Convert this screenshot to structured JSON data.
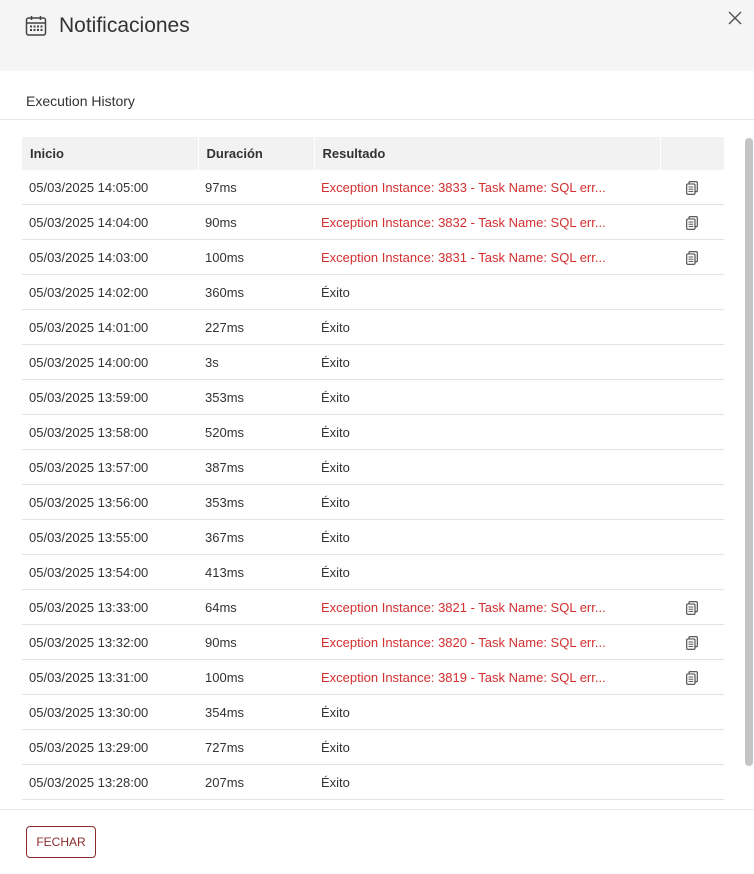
{
  "dialog": {
    "title": "Notificaciones",
    "subtitle": "Execution History",
    "close_icon": "close-icon",
    "title_icon": "calendar-icon"
  },
  "table": {
    "columns": [
      "Inicio",
      "Duración",
      "Resultado",
      ""
    ],
    "rows": [
      {
        "inicio": "05/03/2025 14:05:00",
        "duracion": "97ms",
        "resultado": "Exception Instance: 3833 - Task Name: SQL err...",
        "error": true
      },
      {
        "inicio": "05/03/2025 14:04:00",
        "duracion": "90ms",
        "resultado": "Exception Instance: 3832 - Task Name: SQL err...",
        "error": true
      },
      {
        "inicio": "05/03/2025 14:03:00",
        "duracion": "100ms",
        "resultado": "Exception Instance: 3831 - Task Name: SQL err...",
        "error": true
      },
      {
        "inicio": "05/03/2025 14:02:00",
        "duracion": "360ms",
        "resultado": "Éxito",
        "error": false
      },
      {
        "inicio": "05/03/2025 14:01:00",
        "duracion": "227ms",
        "resultado": "Éxito",
        "error": false
      },
      {
        "inicio": "05/03/2025 14:00:00",
        "duracion": "3s",
        "resultado": "Éxito",
        "error": false
      },
      {
        "inicio": "05/03/2025 13:59:00",
        "duracion": "353ms",
        "resultado": "Éxito",
        "error": false
      },
      {
        "inicio": "05/03/2025 13:58:00",
        "duracion": "520ms",
        "resultado": "Éxito",
        "error": false
      },
      {
        "inicio": "05/03/2025 13:57:00",
        "duracion": "387ms",
        "resultado": "Éxito",
        "error": false
      },
      {
        "inicio": "05/03/2025 13:56:00",
        "duracion": "353ms",
        "resultado": "Éxito",
        "error": false
      },
      {
        "inicio": "05/03/2025 13:55:00",
        "duracion": "367ms",
        "resultado": "Éxito",
        "error": false
      },
      {
        "inicio": "05/03/2025 13:54:00",
        "duracion": "413ms",
        "resultado": "Éxito",
        "error": false
      },
      {
        "inicio": "05/03/2025 13:33:00",
        "duracion": "64ms",
        "resultado": "Exception Instance: 3821 - Task Name: SQL err...",
        "error": true
      },
      {
        "inicio": "05/03/2025 13:32:00",
        "duracion": "90ms",
        "resultado": "Exception Instance: 3820 - Task Name: SQL err...",
        "error": true
      },
      {
        "inicio": "05/03/2025 13:31:00",
        "duracion": "100ms",
        "resultado": "Exception Instance: 3819 - Task Name: SQL err...",
        "error": true
      },
      {
        "inicio": "05/03/2025 13:30:00",
        "duracion": "354ms",
        "resultado": "Éxito",
        "error": false
      },
      {
        "inicio": "05/03/2025 13:29:00",
        "duracion": "727ms",
        "resultado": "Éxito",
        "error": false
      },
      {
        "inicio": "05/03/2025 13:28:00",
        "duracion": "207ms",
        "resultado": "Éxito",
        "error": false
      }
    ],
    "row_action_icon": "copy-document-icon"
  },
  "footer": {
    "close_button_label": "FECHAR"
  },
  "colors": {
    "error_text": "#d32f2f",
    "accent": "#8b2c2c",
    "header_bg": "#f5f5f5"
  }
}
